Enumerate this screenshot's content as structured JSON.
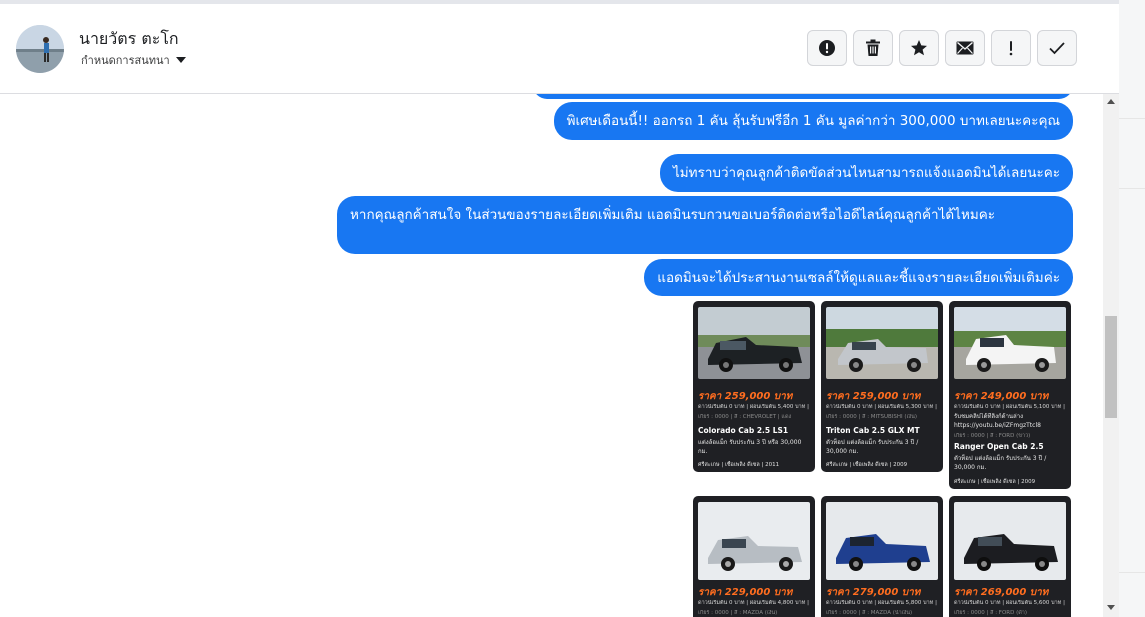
{
  "contact": {
    "name": "นายวัตร ตะโก",
    "status_label": "กำหนดการสนทนา"
  },
  "toolbar": {
    "actions": [
      {
        "icon": "alert-circle-icon"
      },
      {
        "icon": "trash-icon"
      },
      {
        "icon": "star-icon"
      },
      {
        "icon": "mail-icon"
      },
      {
        "icon": "exclamation-icon"
      },
      {
        "icon": "check-icon"
      }
    ]
  },
  "messages": [
    {
      "text": "พิเศษเดือนนี้!! ออกรถ 1 คัน ลุ้นรับฟรีอีก 1 คัน มูลค่ากว่า 300,000 บาทเลยนะคะคุณ"
    },
    {
      "text": "ไม่ทราบว่าคุณลูกค้าติดขัดส่วนไหนสามารถแจ้งแอดมินได้เลยนะคะ"
    },
    {
      "text": "หากคุณลูกค้าสนใจ ในส่วนของรายละเอียดเพิ่มเติม แอดมินรบกวนขอเบอร์ติดต่อหรือไอดีไลน์คุณลูกค้าได้ไหมคะ"
    },
    {
      "text": "แอดมินจะได้ประสานงานเซลล์ให้ดูแลและชี้แจงรายละเอียดเพิ่มเติมค่ะ"
    }
  ],
  "cards": [
    {
      "price": "ราคา 259,000 บาท",
      "model": "Colorado Cab 2.5 LS1",
      "desc": "แต่งล้อแม็ก รับประกัน 3 ปี หรือ 30,000 กม.",
      "youtube": "",
      "foot": "ศรีสะเกษ | เชื้อเพลิง ดีเซล | 2011"
    },
    {
      "price": "ราคา 259,000 บาท",
      "model": "Triton Cab 2.5 GLX MT",
      "desc": "ตัวท็อป แต่งล้อแม็ก รับประกัน 3 ปี / 30,000 กม.",
      "youtube": "",
      "foot": "ศรีสะเกษ | เชื้อเพลิง ดีเซล | 2009"
    },
    {
      "price": "ราคา 249,000 บาท",
      "model": "Ranger Open Cab 2.5",
      "desc": "ตัวท็อป แต่งล้อแม็ก รับประกัน 3 ปี / 30,000 กม.",
      "youtube": "https://youtu.be/iZFmgzTtcl8",
      "foot": "ศรีสะเกษ | เชื้อเพลิง ดีเซล | 2009"
    },
    {
      "price": "ราคา 229,000 บาท",
      "model": "",
      "desc": "",
      "youtube": "",
      "foot": ""
    },
    {
      "price": "ราคา 279,000 บาท",
      "model": "",
      "desc": "",
      "youtube": "",
      "foot": ""
    },
    {
      "price": "ราคา 269,000 บาท",
      "model": "",
      "desc": "",
      "youtube": "",
      "foot": ""
    }
  ],
  "colors": {
    "bubble": "#1877f2",
    "card_bg": "#1f2024",
    "price": "#ff6d1f"
  }
}
